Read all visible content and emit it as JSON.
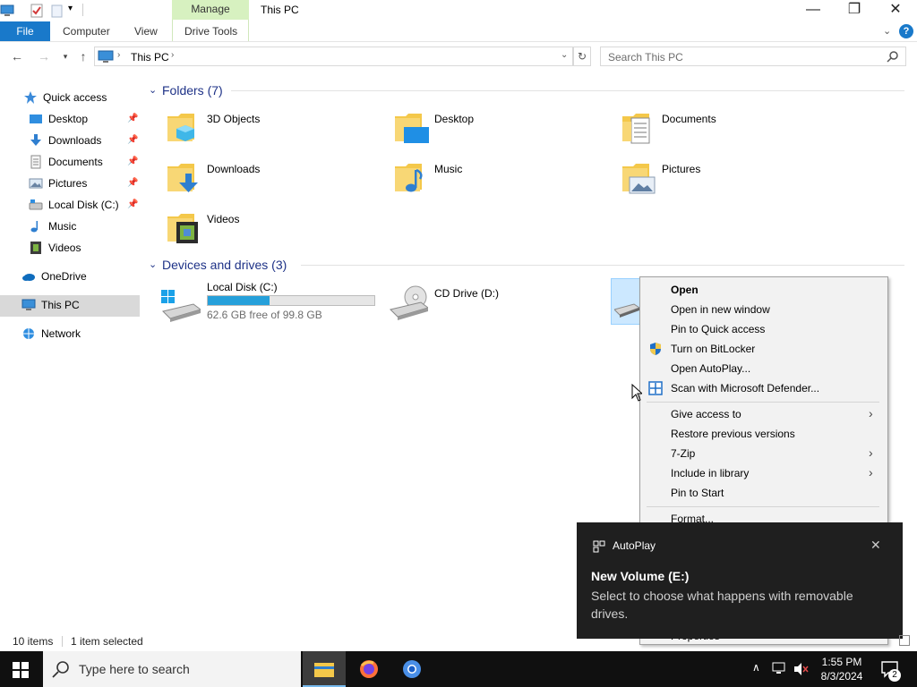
{
  "window": {
    "title": "This PC",
    "context_tab": "Manage",
    "minimize": "—",
    "maximize": "❐",
    "close": "✕"
  },
  "ribbon": {
    "file": "File",
    "tabs": [
      "Computer",
      "View",
      "Drive Tools"
    ]
  },
  "address": {
    "path": "This PC",
    "search_placeholder": "Search This PC"
  },
  "nav_pane": {
    "quick_access": "Quick access",
    "items": [
      {
        "label": "Desktop",
        "pinned": true
      },
      {
        "label": "Downloads",
        "pinned": true
      },
      {
        "label": "Documents",
        "pinned": true
      },
      {
        "label": "Pictures",
        "pinned": true
      },
      {
        "label": "Local Disk (C:)",
        "pinned": true
      },
      {
        "label": "Music",
        "pinned": false
      },
      {
        "label": "Videos",
        "pinned": false
      }
    ],
    "onedrive": "OneDrive",
    "this_pc": "This PC",
    "network": "Network"
  },
  "folders": {
    "heading": "Folders (7)",
    "items": [
      "3D Objects",
      "Desktop",
      "Documents",
      "Downloads",
      "Music",
      "Pictures",
      "Videos"
    ]
  },
  "devices": {
    "heading": "Devices and drives (3)",
    "local_disk": {
      "name": "Local Disk (C:)",
      "free_text": "62.6 GB free of 99.8 GB",
      "used_fraction": 0.373
    },
    "cd_drive": {
      "name": "CD Drive (D:)"
    }
  },
  "context_menu": {
    "items": [
      "Open",
      "Open in new window",
      "Pin to Quick access",
      "Turn on BitLocker",
      "Open AutoPlay...",
      "Scan with Microsoft Defender...",
      "Give access to",
      "Restore previous versions",
      "7-Zip",
      "Include in library",
      "Pin to Start",
      "Format...",
      "Properties"
    ]
  },
  "toast": {
    "app": "AutoPlay",
    "title": "New Volume (E:)",
    "body": "Select to choose what happens with removable drives."
  },
  "status_bar": {
    "count": "10 items",
    "selected": "1 item selected"
  },
  "taskbar": {
    "search_placeholder": "Type here to search",
    "time": "1:55 PM",
    "date": "8/3/2024",
    "notification_count": "2"
  },
  "colors": {
    "accent": "#1979ca",
    "progress": "#26a0da",
    "selection": "#cce8ff",
    "manage_tab": "#d7f1c0",
    "heading": "#1e3287"
  }
}
